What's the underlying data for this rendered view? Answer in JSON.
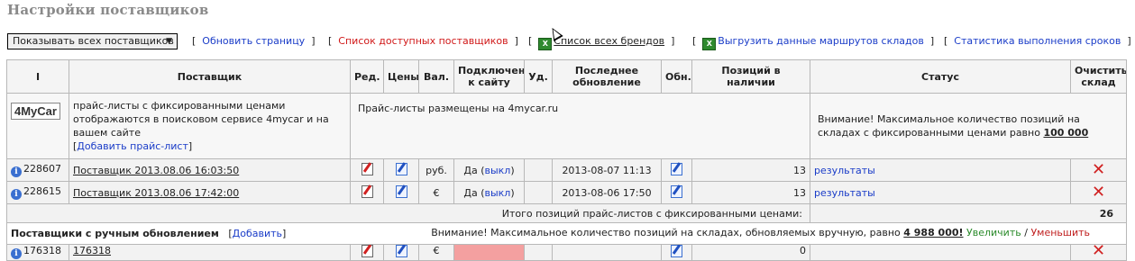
{
  "page": {
    "title": "Настройки поставщиков"
  },
  "toolbar": {
    "select_value": "Показывать всех поставщиков",
    "links": {
      "refresh": "Обновить страницу",
      "available": "Список доступных поставщиков",
      "brands": "Список всех брендов",
      "export_routes": "Выгрузить данные маршрутов складов",
      "stats": "Статистика выполнения сроков"
    }
  },
  "table": {
    "headers": {
      "id": "I",
      "supplier": "Поставщик",
      "edit": "Ред.",
      "prices": "Цены",
      "currency": "Вал.",
      "connected": "Подключен к сайту",
      "del": "Уд.",
      "updated": "Последнее обновление",
      "refresh": "Обн.",
      "stock": "Позиций в наличии",
      "status": "Статус",
      "clear": "Очистить склад"
    },
    "mycar": {
      "logo": "4MyCar",
      "text": "прайс-листы с фиксированными ценами отображаются в поисковом сервисе 4mycar и на вашем сайте",
      "add_link": "Добавить прайс-лист",
      "placed": "Прайс-листы размещены на 4mycar.ru",
      "warning": "Внимание! Максимальное количество позиций на складах с фиксированными ценами равно",
      "max": "100 000"
    },
    "rows": [
      {
        "id": "228607",
        "name": "Поставщик 2013.08.06 16:03:50",
        "currency": "руб.",
        "connected": "Да",
        "toggle": "выкл",
        "updated": "2013-08-07 11:13",
        "stock": "13",
        "status": "результаты"
      },
      {
        "id": "228615",
        "name": "Поставщик 2013.08.06 17:42:00",
        "currency": "€",
        "connected": "Да",
        "toggle": "выкл",
        "updated": "2013-08-06 17:50",
        "stock": "13",
        "status": "результаты"
      }
    ],
    "total": {
      "label": "Итого позиций прайс-листов с фиксированными ценами:",
      "value": "26"
    },
    "manual": {
      "title": "Поставщики с ручным обновлением",
      "add": "Добавить",
      "warning": "Внимание! Максимальное количество позиций на складах, обновляемых вручную, равно",
      "max": "4 988 000!",
      "increase": "Увеличить",
      "separator": "/",
      "decrease": "Уменьшить"
    },
    "partial_row": {
      "id": "176318",
      "name": "176318",
      "currency": "€",
      "stock": "0"
    }
  }
}
